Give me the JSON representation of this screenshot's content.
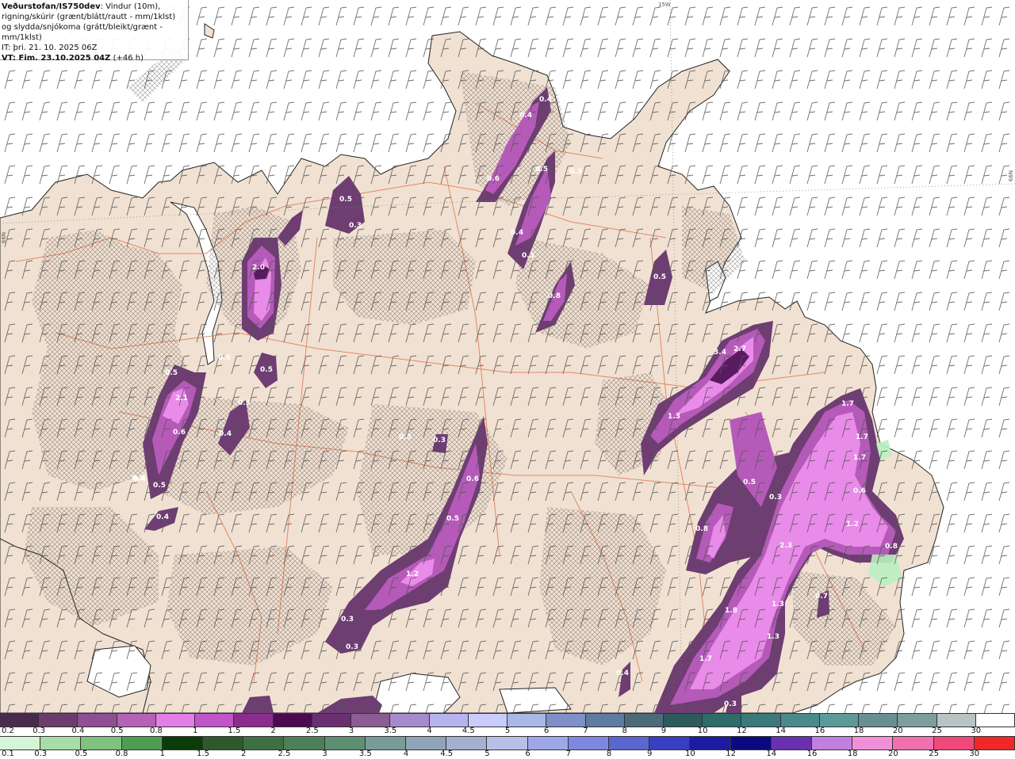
{
  "header": {
    "source": "Veðurstofan/IS750dev",
    "description": ": Vindur (10m), rigning/skúrir (grænt/blátt/rautt - mm/1klst) og slydda/snjókoma (grátt/bleikt/grænt - mm/1klst)",
    "init_time": "IT: þri. 21. 10. 2025 06Z",
    "valid_time_label": "VT: Fim. 23.10.2025 04Z",
    "lead_time": "(+46 h)"
  },
  "graticule": {
    "lon_label": "15W",
    "lat_label_left": "66N",
    "lat_label_right": "66N"
  },
  "precip_values": [
    {
      "label": "0.4"
    },
    {
      "label": "0.4"
    },
    {
      "label": "0.6"
    },
    {
      "label": "0.5"
    },
    {
      "label": "0.3"
    },
    {
      "label": "0.5"
    },
    {
      "label": "0.3"
    },
    {
      "label": "0.4"
    },
    {
      "label": "0.3"
    },
    {
      "label": "0.8"
    },
    {
      "label": "0.5"
    },
    {
      "label": "2.0"
    },
    {
      "label": "0.6"
    },
    {
      "label": "0.5"
    },
    {
      "label": "0.5"
    },
    {
      "label": "2.1"
    },
    {
      "label": "0.6"
    },
    {
      "label": "0.3"
    },
    {
      "label": "0.4"
    },
    {
      "label": "0.3"
    },
    {
      "label": "0.5"
    },
    {
      "label": "0.4"
    },
    {
      "label": "3.4"
    },
    {
      "label": "2.7"
    },
    {
      "label": "1.3"
    },
    {
      "label": "1.7"
    },
    {
      "label": "1.7"
    },
    {
      "label": "1.7"
    },
    {
      "label": "0.3"
    },
    {
      "label": "0.3"
    },
    {
      "label": "0.6"
    },
    {
      "label": "0.5"
    },
    {
      "label": "0.5"
    },
    {
      "label": "0.3"
    },
    {
      "label": "0.6"
    },
    {
      "label": "0.8"
    },
    {
      "label": "1.2"
    },
    {
      "label": "0.8"
    },
    {
      "label": "2.3"
    },
    {
      "label": "1.2"
    },
    {
      "label": "0.3"
    },
    {
      "label": "0.3"
    },
    {
      "label": "1.8"
    },
    {
      "label": "1.3"
    },
    {
      "label": "1.3"
    },
    {
      "label": "0.7"
    },
    {
      "label": "1.7"
    },
    {
      "label": "0.4"
    },
    {
      "label": "0.4"
    },
    {
      "label": "0.3"
    }
  ],
  "legend_snow": {
    "labels": [
      "0.2",
      "0.3",
      "0.4",
      "0.5",
      "0.8",
      "1",
      "1.5",
      "2",
      "2.5",
      "3",
      "3.5",
      "4",
      "4.5",
      "5",
      "6",
      "7",
      "8",
      "9",
      "10",
      "12",
      "14",
      "16",
      "18",
      "20",
      "25",
      "30"
    ],
    "colors": [
      "#4a2a4e",
      "#6b3d6e",
      "#8f4f93",
      "#b461b8",
      "#e37ee6",
      "#c255c9",
      "#8a2d8f",
      "#4d0a52",
      "#6a2f70",
      "#8a5d94",
      "#a58bcc",
      "#b7b3ee",
      "#c9cdf8",
      "#a9b8e6",
      "#7f90c8",
      "#5e7ba0",
      "#4d6a7a",
      "#2d5a5a",
      "#2e6b6b",
      "#3a7a7a",
      "#4a8a8a",
      "#5c9a9a",
      "#6a8f90",
      "#7d9d9e",
      "#b8c4c4",
      "#ffffff"
    ]
  },
  "legend_rain": {
    "labels": [
      "0.1",
      "0.3",
      "0.5",
      "0.8",
      "1",
      "1.5",
      "2",
      "2.5",
      "3",
      "3.5",
      "4",
      "4.5",
      "5",
      "6",
      "7",
      "8",
      "9",
      "10",
      "12",
      "14",
      "16",
      "18",
      "20",
      "25",
      "30"
    ],
    "colors": [
      "#d6f5d6",
      "#a8dca8",
      "#7ec27e",
      "#4f9e4f",
      "#0a3d0a",
      "#2d5a2d",
      "#3f7045",
      "#4d8056",
      "#5e8f70",
      "#7a9c98",
      "#8fa4b8",
      "#a3b0d0",
      "#b8c0e8",
      "#9ea8e8",
      "#7f88e0",
      "#5c66d0",
      "#3a3ec0",
      "#1c1ca0",
      "#0a0a80",
      "#6a30b0",
      "#c080e0",
      "#f090d8",
      "#f070b0",
      "#f04878",
      "#f02828"
    ]
  }
}
